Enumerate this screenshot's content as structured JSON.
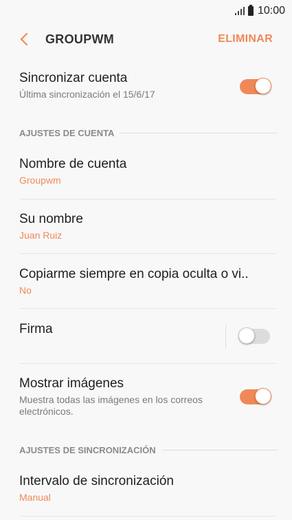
{
  "status_bar": {
    "time": "10:00"
  },
  "app_bar": {
    "title": "GROUPWM",
    "delete_label": "ELIMINAR"
  },
  "sync_account": {
    "title": "Sincronizar cuenta",
    "subtitle": "Última sincronización el 15/6/17",
    "enabled": true
  },
  "sections": {
    "account": "AJUSTES DE CUENTA",
    "sync": "AJUSTES DE SINCRONIZACIÓN"
  },
  "account_name": {
    "title": "Nombre de cuenta",
    "value": "Groupwm"
  },
  "your_name": {
    "title": "Su nombre",
    "value": "Juan Ruiz"
  },
  "bcc": {
    "title": "Copiarme siempre en copia oculta o vi..",
    "value": "No"
  },
  "signature": {
    "title": "Firma",
    "enabled": false
  },
  "show_images": {
    "title": "Mostrar imágenes",
    "subtitle": "Muestra todas las imágenes en los correos electrónicos.",
    "enabled": true
  },
  "sync_interval": {
    "title": "Intervalo de sincronización",
    "value": "Manual"
  },
  "colors": {
    "accent": "#f0895a",
    "background": "#f8f8f8"
  }
}
